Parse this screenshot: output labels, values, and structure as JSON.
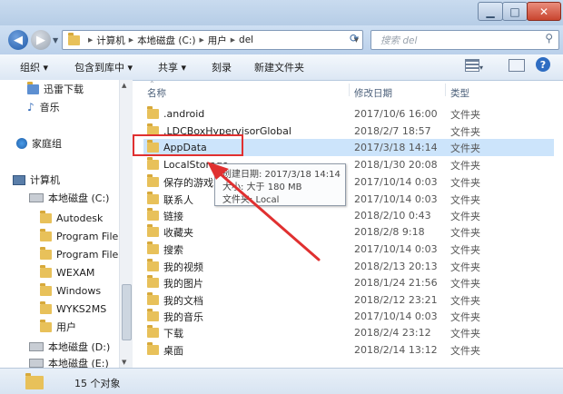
{
  "colors": {
    "highlight_red": "#e03030",
    "selected_bg": "#cce4fb"
  },
  "address": {
    "segments": [
      "计算机",
      "本地磁盘 (C:)",
      "用户",
      "del"
    ],
    "search_placeholder": "搜索 del"
  },
  "toolbar": {
    "organize": "组织",
    "include_library": "包含到库中",
    "share": "共享",
    "burn": "刻录",
    "new_folder": "新建文件夹"
  },
  "nav": {
    "items": [
      {
        "label": "迅雷下载",
        "icon": "folder-download-icon"
      },
      {
        "label": "音乐",
        "icon": "music-icon"
      },
      {
        "label": "家庭组",
        "icon": "homegroup-icon"
      },
      {
        "label": "计算机",
        "icon": "computer-icon"
      },
      {
        "label": "本地磁盘 (C:)",
        "icon": "drive-icon"
      },
      {
        "label": "Autodesk",
        "icon": "folder-icon"
      },
      {
        "label": "Program Files",
        "icon": "folder-icon"
      },
      {
        "label": "Program Files",
        "icon": "folder-icon"
      },
      {
        "label": "WEXAM",
        "icon": "folder-icon"
      },
      {
        "label": "Windows",
        "icon": "folder-icon"
      },
      {
        "label": "WYKS2MS",
        "icon": "folder-icon"
      },
      {
        "label": "用户",
        "icon": "folder-icon"
      },
      {
        "label": "本地磁盘 (D:)",
        "icon": "drive-icon"
      },
      {
        "label": "本地磁盘 (E:)",
        "icon": "drive-icon"
      }
    ]
  },
  "columns": {
    "name": "名称",
    "date": "修改日期",
    "type": "类型"
  },
  "files": [
    {
      "name": ".android",
      "date": "2017/10/6 16:00",
      "type": "文件夹"
    },
    {
      "name": ".LDCBoxHypervisorGlobal",
      "date": "2018/2/7 18:57",
      "type": "文件夹"
    },
    {
      "name": "AppData",
      "date": "2017/3/18 14:14",
      "type": "文件夹"
    },
    {
      "name": "LocalStorage",
      "date": "2018/1/30 20:08",
      "type": "文件夹"
    },
    {
      "name": "保存的游戏",
      "date": "2017/10/14 0:03",
      "type": "文件夹"
    },
    {
      "name": "联系人",
      "date": "2017/10/14 0:03",
      "type": "文件夹"
    },
    {
      "name": "链接",
      "date": "2018/2/10 0:43",
      "type": "文件夹"
    },
    {
      "name": "收藏夹",
      "date": "2018/2/8 9:18",
      "type": "文件夹"
    },
    {
      "name": "搜索",
      "date": "2017/10/14 0:03",
      "type": "文件夹"
    },
    {
      "name": "我的视频",
      "date": "2018/2/13 20:13",
      "type": "文件夹"
    },
    {
      "name": "我的图片",
      "date": "2018/1/24 21:56",
      "type": "文件夹"
    },
    {
      "name": "我的文档",
      "date": "2018/2/12 23:21",
      "type": "文件夹"
    },
    {
      "name": "我的音乐",
      "date": "2017/10/14 0:03",
      "type": "文件夹"
    },
    {
      "name": "下载",
      "date": "2018/2/4 23:12",
      "type": "文件夹"
    },
    {
      "name": "桌面",
      "date": "2018/2/14 13:12",
      "type": "文件夹"
    }
  ],
  "tooltip": {
    "created": "创建日期: 2017/3/18 14:14",
    "size": "大小: 大于 180 MB",
    "folder": "文件夹: Local"
  },
  "status": {
    "count": "15 个对象"
  }
}
